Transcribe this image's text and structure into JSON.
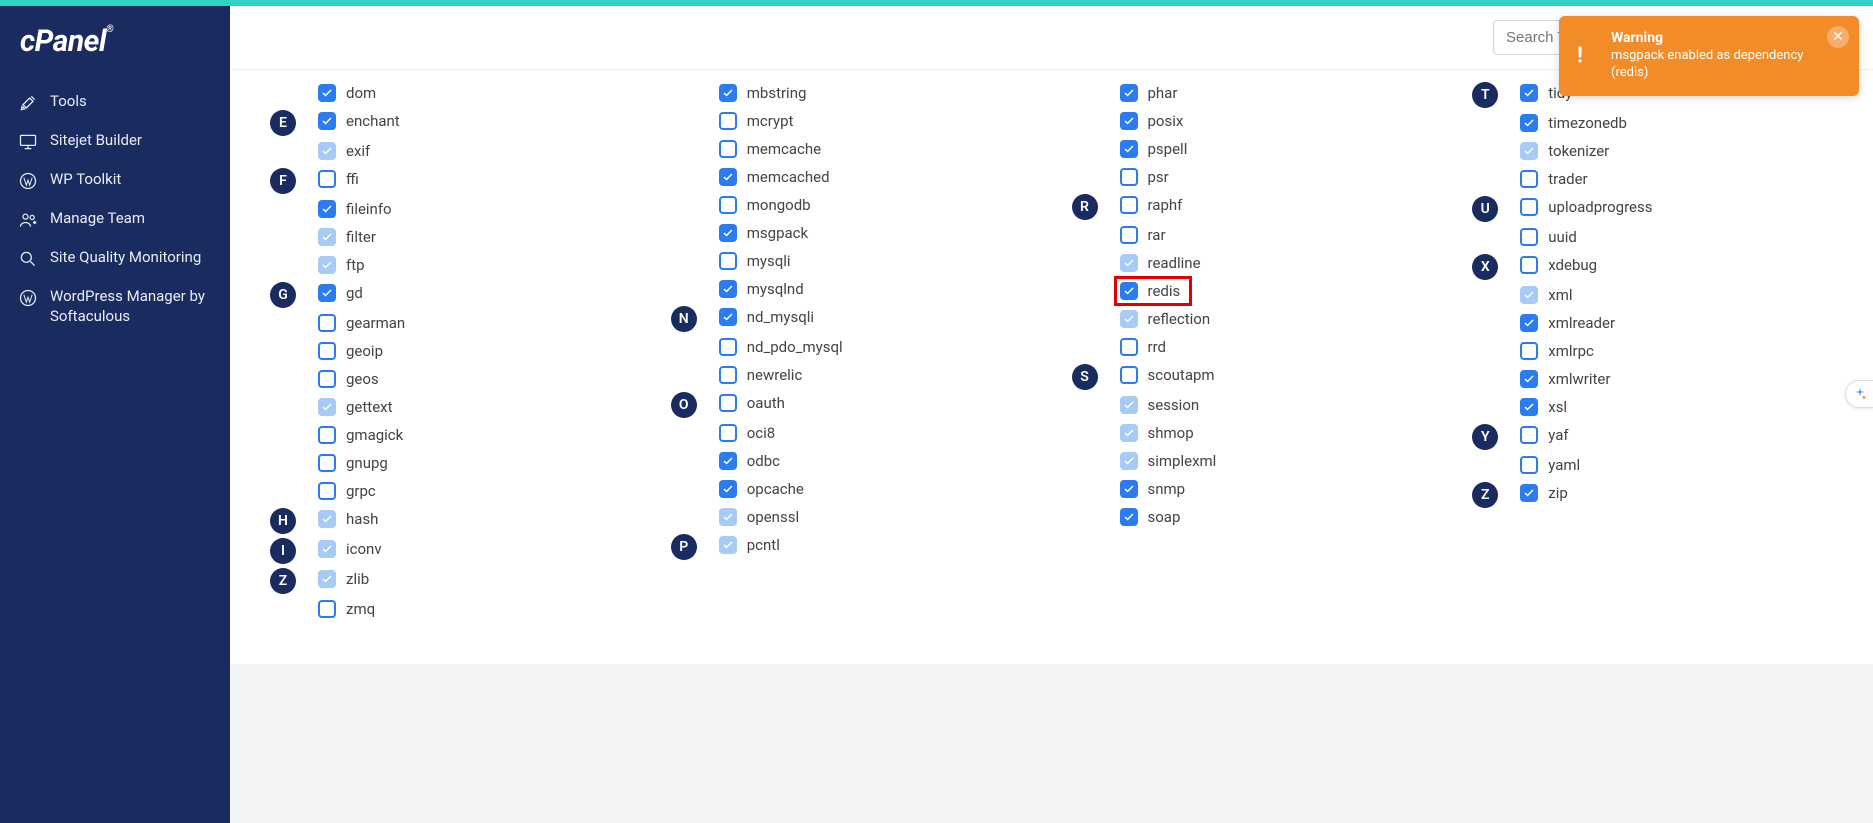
{
  "search": {
    "placeholder": "Search Tools (/)"
  },
  "sidebar": {
    "logo": "cPanel",
    "items": [
      {
        "label": "Tools",
        "icon": "tools"
      },
      {
        "label": "Sitejet Builder",
        "icon": "monitor"
      },
      {
        "label": "WP Toolkit",
        "icon": "wp"
      },
      {
        "label": "Manage Team",
        "icon": "team"
      },
      {
        "label": "Site Quality Monitoring",
        "icon": "magnify"
      },
      {
        "label": "WordPress Manager by Softaculous",
        "icon": "wp"
      }
    ]
  },
  "toast": {
    "title": "Warning",
    "message": "msgpack enabled as dependency (redis)"
  },
  "columns": [
    [
      {
        "letter": "",
        "items": [
          {
            "n": "dom",
            "s": "checked"
          }
        ]
      },
      {
        "letter": "E",
        "items": [
          {
            "n": "enchant",
            "s": "checked"
          },
          {
            "n": "exif",
            "s": "locked"
          }
        ]
      },
      {
        "letter": "F",
        "items": [
          {
            "n": "ffi",
            "s": "unchecked"
          },
          {
            "n": "fileinfo",
            "s": "checked"
          },
          {
            "n": "filter",
            "s": "locked"
          },
          {
            "n": "ftp",
            "s": "locked"
          }
        ]
      },
      {
        "letter": "G",
        "items": [
          {
            "n": "gd",
            "s": "checked"
          },
          {
            "n": "gearman",
            "s": "unchecked"
          },
          {
            "n": "geoip",
            "s": "unchecked"
          },
          {
            "n": "geos",
            "s": "unchecked"
          },
          {
            "n": "gettext",
            "s": "locked"
          },
          {
            "n": "gmagick",
            "s": "unchecked"
          },
          {
            "n": "gnupg",
            "s": "unchecked"
          },
          {
            "n": "grpc",
            "s": "unchecked"
          }
        ]
      },
      {
        "letter": "H",
        "items": [
          {
            "n": "hash",
            "s": "locked"
          }
        ]
      },
      {
        "letter": "I",
        "items": [
          {
            "n": "iconv",
            "s": "locked"
          }
        ]
      },
      {
        "letter": "Z",
        "items": [
          {
            "n": "zlib",
            "s": "locked"
          },
          {
            "n": "zmq",
            "s": "unchecked"
          }
        ]
      }
    ],
    [
      {
        "letter": "",
        "items": [
          {
            "n": "mbstring",
            "s": "checked"
          },
          {
            "n": "mcrypt",
            "s": "unchecked"
          },
          {
            "n": "memcache",
            "s": "unchecked"
          },
          {
            "n": "memcached",
            "s": "checked"
          },
          {
            "n": "mongodb",
            "s": "unchecked"
          },
          {
            "n": "msgpack",
            "s": "checked"
          },
          {
            "n": "mysqli",
            "s": "unchecked"
          },
          {
            "n": "mysqlnd",
            "s": "checked"
          }
        ]
      },
      {
        "letter": "N",
        "items": [
          {
            "n": "nd_mysqli",
            "s": "checked"
          },
          {
            "n": "nd_pdo_mysql",
            "s": "unchecked"
          },
          {
            "n": "newrelic",
            "s": "unchecked"
          }
        ]
      },
      {
        "letter": "O",
        "items": [
          {
            "n": "oauth",
            "s": "unchecked"
          },
          {
            "n": "oci8",
            "s": "unchecked"
          },
          {
            "n": "odbc",
            "s": "checked"
          },
          {
            "n": "opcache",
            "s": "checked"
          },
          {
            "n": "openssl",
            "s": "locked"
          }
        ]
      },
      {
        "letter": "P",
        "items": [
          {
            "n": "pcntl",
            "s": "locked"
          }
        ]
      }
    ],
    [
      {
        "letter": "",
        "items": [
          {
            "n": "phar",
            "s": "checked"
          },
          {
            "n": "posix",
            "s": "checked"
          },
          {
            "n": "pspell",
            "s": "checked"
          },
          {
            "n": "psr",
            "s": "unchecked"
          }
        ]
      },
      {
        "letter": "R",
        "items": [
          {
            "n": "raphf",
            "s": "unchecked"
          },
          {
            "n": "rar",
            "s": "unchecked"
          },
          {
            "n": "readline",
            "s": "locked"
          },
          {
            "n": "redis",
            "s": "checked",
            "hl": true
          },
          {
            "n": "reflection",
            "s": "locked"
          },
          {
            "n": "rrd",
            "s": "unchecked"
          }
        ]
      },
      {
        "letter": "S",
        "items": [
          {
            "n": "scoutapm",
            "s": "unchecked"
          },
          {
            "n": "session",
            "s": "locked"
          },
          {
            "n": "shmop",
            "s": "locked"
          },
          {
            "n": "simplexml",
            "s": "locked"
          },
          {
            "n": "snmp",
            "s": "checked"
          },
          {
            "n": "soap",
            "s": "checked"
          }
        ]
      }
    ],
    [
      {
        "letter": "T",
        "items": [
          {
            "n": "tidy",
            "s": "checked"
          },
          {
            "n": "timezonedb",
            "s": "checked"
          },
          {
            "n": "tokenizer",
            "s": "locked"
          },
          {
            "n": "trader",
            "s": "unchecked"
          }
        ]
      },
      {
        "letter": "U",
        "items": [
          {
            "n": "uploadprogress",
            "s": "unchecked"
          },
          {
            "n": "uuid",
            "s": "unchecked"
          }
        ]
      },
      {
        "letter": "X",
        "items": [
          {
            "n": "xdebug",
            "s": "unchecked"
          },
          {
            "n": "xml",
            "s": "locked"
          },
          {
            "n": "xmlreader",
            "s": "checked"
          },
          {
            "n": "xmlrpc",
            "s": "unchecked"
          },
          {
            "n": "xmlwriter",
            "s": "checked"
          },
          {
            "n": "xsl",
            "s": "checked"
          }
        ]
      },
      {
        "letter": "Y",
        "items": [
          {
            "n": "yaf",
            "s": "unchecked"
          },
          {
            "n": "yaml",
            "s": "unchecked"
          }
        ]
      },
      {
        "letter": "Z",
        "items": [
          {
            "n": "zip",
            "s": "checked"
          }
        ]
      }
    ]
  ]
}
